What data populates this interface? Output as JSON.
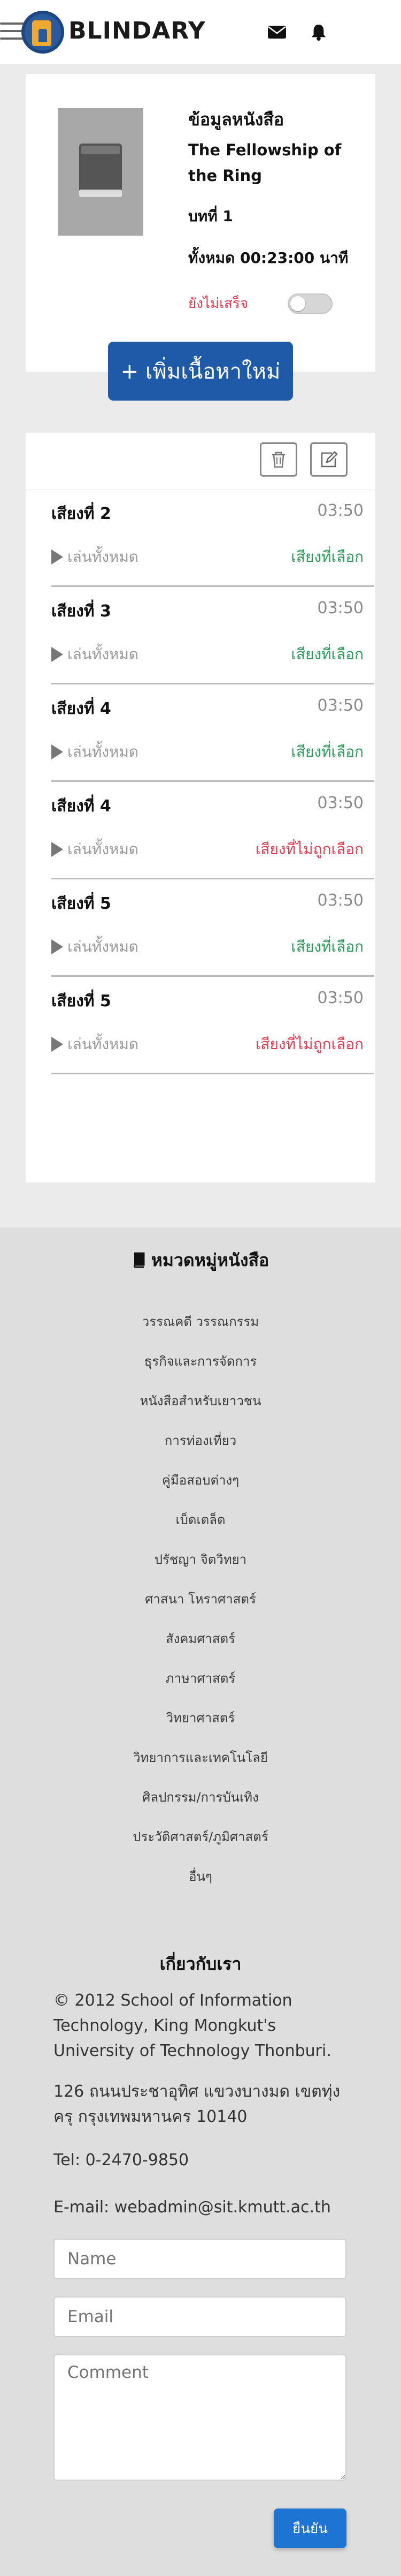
{
  "header": {
    "brand": "BLINDARY",
    "icons": [
      "envelope-icon",
      "bell-icon",
      "hamburger-menu-icon"
    ]
  },
  "book_info": {
    "title": "ข้อมูลหนังสือ",
    "book_name": "The Fellowship of the Ring",
    "chapter": "บทที่ 1",
    "total": "ทั้งหมด 00:23:00 นาที",
    "status": "ยังไม่เสร็จ",
    "status_color": "#e53a50",
    "toggle_on": false
  },
  "add_button": {
    "label": "+ เพิ่มเนื้อหาใหม่"
  },
  "toolbar": {
    "icons": [
      "trash-icon",
      "edit-icon"
    ]
  },
  "tracks": [
    {
      "name": "เสียงที่ 2",
      "time": "03:50",
      "play": "เล่นทั้งหมด",
      "status": "เสียงที่เลือก",
      "selected": true
    },
    {
      "name": "เสียงที่ 3",
      "time": "03:50",
      "play": "เล่นทั้งหมด",
      "status": "เสียงที่เลือก",
      "selected": true
    },
    {
      "name": "เสียงที่ 4",
      "time": "03:50",
      "play": "เล่นทั้งหมด",
      "status": "เสียงที่เลือก",
      "selected": true
    },
    {
      "name": "เสียงที่ 4",
      "time": "03:50",
      "play": "เล่นทั้งหมด",
      "status": "เสียงที่ไม่ถูกเลือก",
      "selected": false
    },
    {
      "name": "เสียงที่ 5",
      "time": "03:50",
      "play": "เล่นทั้งหมด",
      "status": "เสียงที่เลือก",
      "selected": true
    },
    {
      "name": "เสียงที่ 5",
      "time": "03:50",
      "play": "เล่นทั้งหมด",
      "status": "เสียงที่ไม่ถูกเลือก",
      "selected": false
    }
  ],
  "colors": {
    "selected": "#2e9a5c",
    "unselected": "#e53a50",
    "primary": "#1e5aa8"
  },
  "categories": {
    "heading": "หมวดหมู่หนังสือ",
    "items": [
      "วรรณคดี วรรณกรรม",
      "ธุรกิจและการจัดการ",
      "หนังสือสำหรับเยาวชน",
      "การท่องเที่ยว",
      "คู่มือสอบต่างๆ",
      "เบ็ดเตล็ด",
      "ปรัชญา จิตวิทยา",
      "ศาสนา โหราศาสตร์",
      "สังคมศาสตร์",
      "ภาษาศาสตร์",
      "วิทยาศาสตร์",
      "วิทยาการและเทคโนโลยี",
      "ศิลปกรรม/การบันเทิง",
      "ประวัติศาสตร์/ภูมิศาสตร์",
      "อื่นๆ"
    ]
  },
  "about": {
    "heading": "เกี่ยวกับเรา",
    "copyright": "© 2012 School of Information Technology, King Mongkut's University of Technology Thonburi.",
    "address": "126 ถนนประชาอุทิศ แขวงบางมด เขตทุ่งครุ กรุงเทพมหานคร 10140",
    "tel": "Tel: 0-2470-9850",
    "email": "E-mail: webadmin@sit.kmutt.ac.th"
  },
  "form": {
    "name_placeholder": "Name",
    "email_placeholder": "Email",
    "comment_placeholder": "Comment",
    "submit_label": "ยืนยัน"
  }
}
